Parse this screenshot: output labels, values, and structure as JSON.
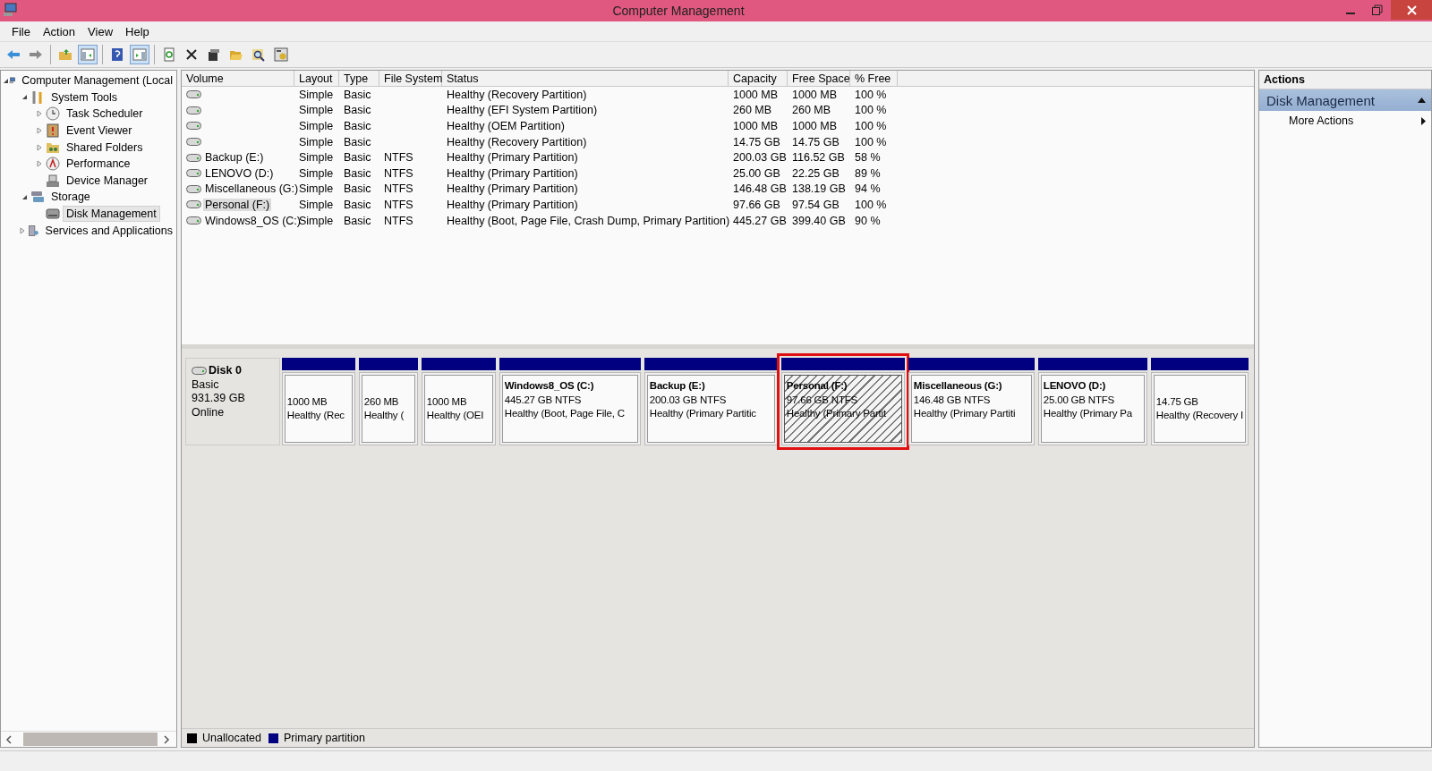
{
  "window": {
    "title": "Computer Management"
  },
  "menu": [
    "File",
    "Action",
    "View",
    "Help"
  ],
  "toolbar": [
    {
      "kind": "back",
      "pressed": false
    },
    {
      "kind": "forward",
      "pressed": false
    },
    {
      "kind": "sep"
    },
    {
      "kind": "up",
      "pressed": false
    },
    {
      "kind": "tree",
      "pressed": true
    },
    {
      "kind": "sep"
    },
    {
      "kind": "help",
      "pressed": false
    },
    {
      "kind": "pane",
      "pressed": true
    },
    {
      "kind": "sep"
    },
    {
      "kind": "refresh",
      "pressed": false
    },
    {
      "kind": "delete",
      "pressed": false
    },
    {
      "kind": "properties",
      "pressed": false
    },
    {
      "kind": "open",
      "pressed": false
    },
    {
      "kind": "search",
      "pressed": false
    },
    {
      "kind": "settings",
      "pressed": false
    }
  ],
  "tree": [
    {
      "label": "Computer Management (Local",
      "selected": false,
      "expanded": true,
      "children": [
        {
          "label": "System Tools",
          "selected": false,
          "expanded": true,
          "children": [
            {
              "label": "Task Scheduler",
              "selected": false,
              "expanded": false
            },
            {
              "label": "Event Viewer",
              "selected": false,
              "expanded": false
            },
            {
              "label": "Shared Folders",
              "selected": false,
              "expanded": false
            },
            {
              "label": "Performance",
              "selected": false,
              "expanded": false
            },
            {
              "label": "Device Manager",
              "selected": false
            }
          ]
        },
        {
          "label": "Storage",
          "selected": false,
          "expanded": true,
          "children": [
            {
              "label": "Disk Management",
              "selected": true
            }
          ]
        },
        {
          "label": "Services and Applications",
          "selected": false,
          "expanded": false
        }
      ]
    }
  ],
  "volumes": {
    "columns": [
      "Volume",
      "Layout",
      "Type",
      "File System",
      "Status",
      "Capacity",
      "Free Space",
      "% Free"
    ],
    "rows": [
      {
        "selected": false,
        "cells": [
          "",
          "Simple",
          "Basic",
          "",
          "Healthy (Recovery Partition)",
          "1000 MB",
          "1000 MB",
          "100 %"
        ]
      },
      {
        "selected": false,
        "cells": [
          "",
          "Simple",
          "Basic",
          "",
          "Healthy (EFI System Partition)",
          "260 MB",
          "260 MB",
          "100 %"
        ]
      },
      {
        "selected": false,
        "cells": [
          "",
          "Simple",
          "Basic",
          "",
          "Healthy (OEM Partition)",
          "1000 MB",
          "1000 MB",
          "100 %"
        ]
      },
      {
        "selected": false,
        "cells": [
          "",
          "Simple",
          "Basic",
          "",
          "Healthy (Recovery Partition)",
          "14.75 GB",
          "14.75 GB",
          "100 %"
        ]
      },
      {
        "selected": false,
        "cells": [
          "Backup (E:)",
          "Simple",
          "Basic",
          "NTFS",
          "Healthy (Primary Partition)",
          "200.03 GB",
          "116.52 GB",
          "58 %"
        ]
      },
      {
        "selected": false,
        "cells": [
          "LENOVO (D:)",
          "Simple",
          "Basic",
          "NTFS",
          "Healthy (Primary Partition)",
          "25.00 GB",
          "22.25 GB",
          "89 %"
        ]
      },
      {
        "selected": false,
        "cells": [
          "Miscellaneous (G:)",
          "Simple",
          "Basic",
          "NTFS",
          "Healthy (Primary Partition)",
          "146.48 GB",
          "138.19 GB",
          "94 %"
        ]
      },
      {
        "selected": true,
        "cells": [
          "Personal (F:)",
          "Simple",
          "Basic",
          "NTFS",
          "Healthy (Primary Partition)",
          "97.66 GB",
          "97.54 GB",
          "100 %"
        ]
      },
      {
        "selected": false,
        "cells": [
          "Windows8_OS (C:)",
          "Simple",
          "Basic",
          "NTFS",
          "Healthy (Boot, Page File, Crash Dump, Primary Partition)",
          "445.27 GB",
          "399.40 GB",
          "90 %"
        ]
      }
    ]
  },
  "disk": {
    "name": "Disk 0",
    "type": "Basic",
    "size": "931.39 GB",
    "status": "Online",
    "partitions": [
      {
        "selected": false,
        "highlighted": false,
        "lines": [
          "1000 MB",
          "Healthy (Rec"
        ]
      },
      {
        "selected": false,
        "highlighted": false,
        "lines": [
          "260 MB",
          "Healthy ("
        ]
      },
      {
        "selected": false,
        "highlighted": false,
        "lines": [
          "1000 MB",
          "Healthy (OEI"
        ]
      },
      {
        "selected": false,
        "highlighted": false,
        "name": "Windows8_OS  (C:)",
        "lines": [
          "445.27 GB NTFS",
          "Healthy (Boot, Page File, C"
        ]
      },
      {
        "selected": false,
        "highlighted": false,
        "name": "Backup  (E:)",
        "lines": [
          "200.03 GB NTFS",
          "Healthy (Primary Partitic"
        ]
      },
      {
        "selected": true,
        "highlighted": true,
        "name": "Personal  (F:)",
        "lines": [
          "97.66 GB NTFS",
          "Healthy (Primary Partit"
        ]
      },
      {
        "selected": false,
        "highlighted": false,
        "name": "Miscellaneous  (G:)",
        "lines": [
          "146.48 GB NTFS",
          "Healthy (Primary Partiti"
        ]
      },
      {
        "selected": false,
        "highlighted": false,
        "name": "LENOVO  (D:)",
        "lines": [
          "25.00 GB NTFS",
          "Healthy (Primary Pa"
        ]
      },
      {
        "selected": false,
        "highlighted": false,
        "lines": [
          "14.75 GB",
          "Healthy (Recovery I"
        ]
      }
    ]
  },
  "legend": [
    {
      "label": "Unallocated",
      "color": "#000000"
    },
    {
      "label": "Primary partition",
      "color": "#000080"
    }
  ],
  "actions": {
    "title": "Actions",
    "section": {
      "label": "Disk Management",
      "expanded": true
    },
    "items": [
      {
        "label": "More Actions"
      }
    ]
  }
}
